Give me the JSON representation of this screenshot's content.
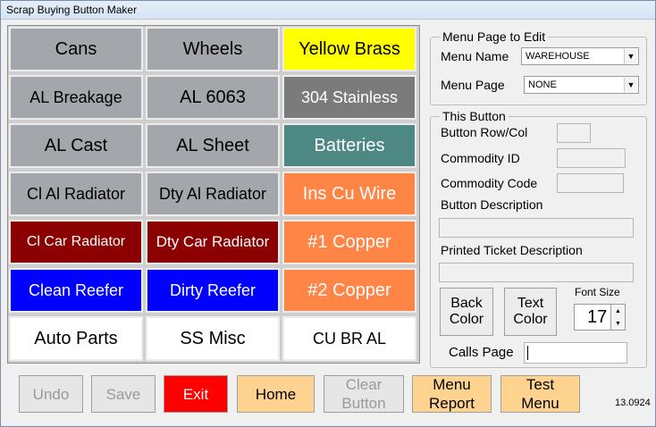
{
  "window": {
    "title": "Scrap Buying Button Maker"
  },
  "tiles": [
    {
      "label": "Cans",
      "bg": "#a3a6aa",
      "fg": "#000000",
      "size": 20
    },
    {
      "label": "Wheels",
      "bg": "#a3a6aa",
      "fg": "#000000",
      "size": 20
    },
    {
      "label": "Yellow Brass",
      "bg": "#ffff00",
      "fg": "#000000",
      "size": 20
    },
    {
      "label": "AL Breakage",
      "bg": "#a3a6aa",
      "fg": "#000000",
      "size": 18
    },
    {
      "label": "AL 6063",
      "bg": "#a3a6aa",
      "fg": "#000000",
      "size": 20
    },
    {
      "label": "304 Stainless",
      "bg": "#7b7b7b",
      "fg": "#ffffff",
      "size": 18
    },
    {
      "label": "AL Cast",
      "bg": "#a3a6aa",
      "fg": "#000000",
      "size": 20
    },
    {
      "label": "AL Sheet",
      "bg": "#a3a6aa",
      "fg": "#000000",
      "size": 20
    },
    {
      "label": "Batteries",
      "bg": "#4e8885",
      "fg": "#ffffff",
      "size": 20
    },
    {
      "label": "Cl Al Radiator",
      "bg": "#a3a6aa",
      "fg": "#000000",
      "size": 18
    },
    {
      "label": "Dty Al Radiator",
      "bg": "#a3a6aa",
      "fg": "#000000",
      "size": 18
    },
    {
      "label": "Ins Cu Wire",
      "bg": "#ff8547",
      "fg": "#ffffff",
      "size": 20
    },
    {
      "label": "Cl Car Radiator",
      "bg": "#8b0000",
      "fg": "#ffffff",
      "size": 16
    },
    {
      "label": "Dty Car Radiator",
      "bg": "#8b0000",
      "fg": "#ffffff",
      "size": 17
    },
    {
      "label": "#1 Copper",
      "bg": "#ff8547",
      "fg": "#ffffff",
      "size": 20
    },
    {
      "label": "Clean Reefer",
      "bg": "#0000ff",
      "fg": "#ffffff",
      "size": 18
    },
    {
      "label": "Dirty Reefer",
      "bg": "#0000ff",
      "fg": "#ffffff",
      "size": 18
    },
    {
      "label": "#2 Copper",
      "bg": "#ff8547",
      "fg": "#ffffff",
      "size": 20
    },
    {
      "label": "Auto Parts",
      "bg": "#ffffff",
      "fg": "#000000",
      "size": 20
    },
    {
      "label": "SS Misc",
      "bg": "#ffffff",
      "fg": "#000000",
      "size": 20
    },
    {
      "label": "CU BR AL",
      "bg": "#ffffff",
      "fg": "#000000",
      "size": 18
    }
  ],
  "menu_page": {
    "legend": "Menu Page to Edit",
    "menu_name_label": "Menu Name",
    "menu_name_value": "WAREHOUSE",
    "menu_page_label": "Menu Page",
    "menu_page_value": "NONE"
  },
  "this_button": {
    "legend": "This Button",
    "row_col_label": "Button Row/Col",
    "row_col_value": "",
    "commodity_id_label": "Commodity ID",
    "commodity_id_value": "",
    "commodity_code_label": "Commodity Code",
    "commodity_code_value": "",
    "description_label": "Button Description",
    "description_value": "",
    "ticket_label": "Printed Ticket Description",
    "ticket_value": "",
    "back_color": "Back Color",
    "text_color": "Text Color",
    "font_size_label": "Font Size",
    "font_size_value": "17",
    "calls_page_label": "Calls Page",
    "calls_page_value": ""
  },
  "toolbar": {
    "undo": "Undo",
    "save": "Save",
    "exit": "Exit",
    "home": "Home",
    "clear": "Clear Button",
    "menu_report": "Menu Report",
    "test_menu": "Test Menu"
  },
  "version": "13.0924"
}
